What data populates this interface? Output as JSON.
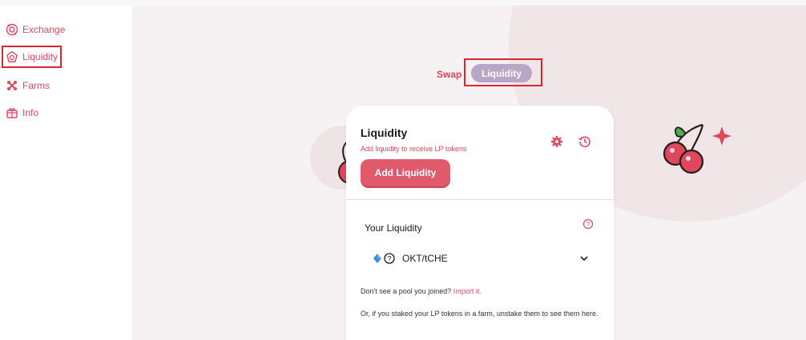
{
  "sidebar": {
    "items": [
      {
        "label": "Exchange",
        "icon": "exchange-icon"
      },
      {
        "label": "Liquidity",
        "icon": "liquidity-icon",
        "active": true
      },
      {
        "label": "Farms",
        "icon": "farms-icon"
      },
      {
        "label": "Info",
        "icon": "info-icon"
      }
    ]
  },
  "tabs": {
    "swap": "Swap",
    "liquidity": "Liquidity"
  },
  "card": {
    "title": "Liquidity",
    "subtitle": "Add liquidity to receive LP tokens",
    "add_button": "Add Liquidity",
    "your_liquidity": "Your Liquidity",
    "pool_pair": "OKT/tCHE",
    "note_prefix": "Don't see a pool you joined?",
    "note_link": "Import it.",
    "note2": "Or, if you staked your LP tokens in a farm, unstake them to see them here."
  },
  "colors": {
    "accent": "#e0475d",
    "tab_active_bg": "#b9a6c7",
    "highlight_box": "#d8282f",
    "background": "#f6f1f2"
  }
}
